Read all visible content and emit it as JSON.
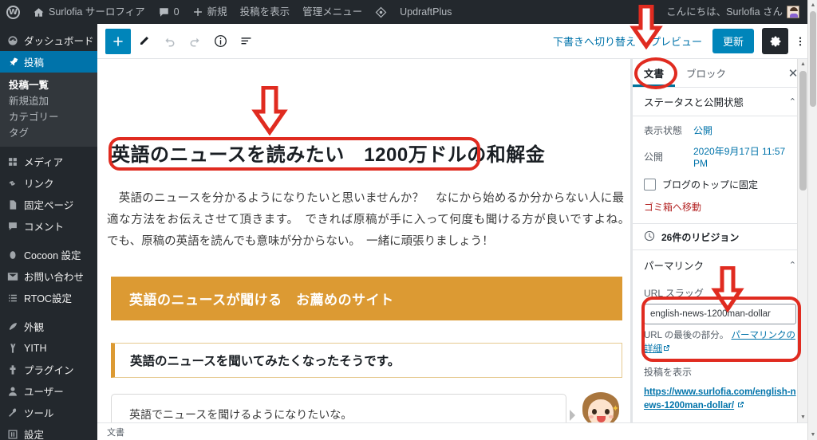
{
  "adminbar": {
    "site_name": "Surlofia サーロフィア",
    "comment_count": "0",
    "new_label": "新規",
    "view_post_label": "投稿を表示",
    "admin_menu_label": "管理メニュー",
    "updraft_label": "UpdraftPlus",
    "greeting": "こんにちは、Surlofia さん"
  },
  "sidebar": {
    "items": [
      {
        "label": "ダッシュボード",
        "icon": "dashboard-icon"
      },
      {
        "label": "投稿",
        "icon": "pin-icon",
        "current": true
      },
      {
        "label": "メディア",
        "icon": "media-icon"
      },
      {
        "label": "リンク",
        "icon": "link-icon"
      },
      {
        "label": "固定ページ",
        "icon": "pages-icon"
      },
      {
        "label": "コメント",
        "icon": "comment-icon"
      },
      {
        "label": "Cocoon 設定",
        "icon": "cocoon-icon"
      },
      {
        "label": "お問い合わせ",
        "icon": "mail-icon"
      },
      {
        "label": "RTOC設定",
        "icon": "list-icon"
      },
      {
        "label": "外観",
        "icon": "appearance-icon"
      },
      {
        "label": "YITH",
        "icon": "yith-icon"
      },
      {
        "label": "プラグイン",
        "icon": "plugin-icon"
      },
      {
        "label": "ユーザー",
        "icon": "user-icon"
      },
      {
        "label": "ツール",
        "icon": "tools-icon"
      },
      {
        "label": "設定",
        "icon": "settings-icon"
      }
    ],
    "submenu": [
      {
        "label": "投稿一覧",
        "active": true
      },
      {
        "label": "新規追加",
        "active": false
      },
      {
        "label": "カテゴリー",
        "active": false
      },
      {
        "label": "タグ",
        "active": false
      }
    ]
  },
  "editor_header": {
    "add_block_icon": "plus-icon",
    "edit_icon": "pencil-icon",
    "undo_icon": "undo-icon",
    "redo_icon": "redo-icon",
    "info_icon": "info-icon",
    "outline_icon": "block-navigation-icon",
    "switch_to_draft": "下書きへ切り替え",
    "preview": "プレビュー",
    "update": "更新",
    "settings_icon": "gear-icon",
    "more_icon": "more-vertical-icon"
  },
  "content": {
    "title": "英語のニュースを読みたい　1200万ドルの和解金",
    "paragraph": "　英語のニュースを分かるようになりたいと思いませんか？　なにから始めるか分からない人に最適な方法をお伝えさせて頂きます。　できれば原稿が手に入って何度も聞ける方が良いですよね。　でも、原稿の英語を読んでも意味が分からない。　一緒に頑張りましょう！",
    "orange_heading": "英語のニュースが聞ける　お薦めのサイト",
    "white_heading": "英語のニュースを聞いてみたくなったそうです。",
    "balloon_text": "英語でニュースを聞けるようになりたいな。",
    "breadcrumb": "文書",
    "orange_color": "#dc9a33"
  },
  "settings": {
    "tabs": [
      {
        "label": "文書",
        "active": true
      },
      {
        "label": "ブロック",
        "active": false
      }
    ],
    "close_icon": "close-icon",
    "status_panel": {
      "title": "ステータスと公開状態",
      "visibility_label": "表示状態",
      "visibility_value": "公開",
      "publish_label": "公開",
      "publish_value": "2020年9月17日 11:57 PM",
      "sticky_label": "ブログのトップに固定",
      "trash_label": "ゴミ箱へ移動"
    },
    "revisions": "26件のリビジョン",
    "permalink_panel": {
      "title": "パーマリンク",
      "slug_label": "URL スラッグ",
      "slug_value": "english-news-1200man-dollar",
      "slug_placeholder": "english-news-1200man-dollar",
      "help_prefix": "URL の最後の部分。",
      "help_link": "パーマリンクの詳細",
      "view_post_label": "投稿を表示",
      "post_url": "https://www.surlofia.com/english-news-1200man-dollar/"
    }
  },
  "annotations": {
    "color": "#e02b20",
    "arrow_title": "down-arrow-to-title",
    "arrow_document_tab": "down-arrow-to-document-tab",
    "arrow_permalink": "down-arrow-to-url-slug",
    "ellipse_document_tab": "ellipse-document-tab",
    "rect_title": "rect-post-title",
    "rect_permalink": "rect-permalink-section"
  }
}
